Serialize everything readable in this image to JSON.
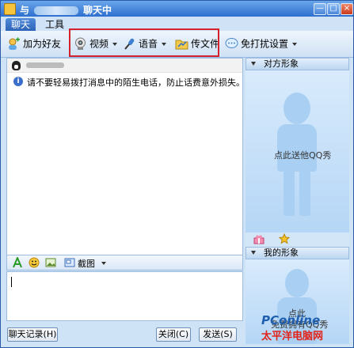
{
  "title": {
    "prefix": "与",
    "suffix": "聊天中"
  },
  "window_controls": {
    "minimize": "—",
    "maximize": "□",
    "close": "×"
  },
  "tabs": [
    {
      "label": "聊天"
    },
    {
      "label": "工具"
    }
  ],
  "toolbar": {
    "add_friend": "加为好友",
    "video": "视频",
    "voice": "语音",
    "send_file": "传文件",
    "do_not_disturb": "免打扰设置"
  },
  "chat": {
    "warning": "请不要轻易拨打消息中的陌生电话，防止话费意外损失。"
  },
  "input_toolbar": {
    "screenshot": "截图"
  },
  "buttons": {
    "history": "聊天记录(H)",
    "close": "关闭(C)",
    "send": "发送(S)"
  },
  "side": {
    "peer_header": "对方形象",
    "peer_show_text": "点此送他QQ秀",
    "my_header": "我的形象",
    "my_show_text_1": "点此",
    "my_show_text_2": "免费拥有QQ秀"
  },
  "watermark": {
    "brand": "PConline",
    "site": "太平洋电脑网"
  },
  "colors": {
    "accent": "#2d6fcf",
    "highlight_box": "#d4212b"
  }
}
